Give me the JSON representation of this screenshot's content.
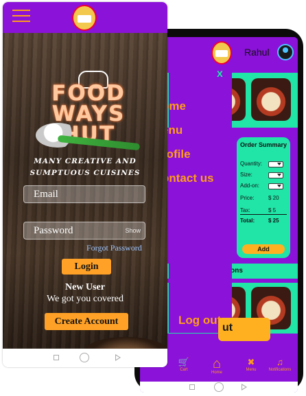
{
  "front_screen": {
    "logo_text": "FOOD WAYS HUT",
    "tagline_1": "MANY CREATIVE AND",
    "tagline_2": "SUMPTUOUS CUISINES",
    "email_placeholder": "Email",
    "password_placeholder": "Password",
    "show_label": "Show",
    "forgot_password": "Forgot Password",
    "login_button": "Login",
    "new_user_heading": "New User",
    "new_user_sub": "We got you covered",
    "create_account_button": "Create Account"
  },
  "back_screen": {
    "user_name": "Rahul",
    "drawer_close": "x",
    "drawer_items": [
      "ome",
      "enu",
      "rofile",
      "ontact us"
    ],
    "logout": "Log out",
    "button_fragment": "ut",
    "order_summary": {
      "title": "Order Summary",
      "quantity_label": "Quantity:",
      "size_label": "Size:",
      "addon_label": "Add-on:",
      "price_label": "Price:",
      "price_value": "$ 20",
      "tax_label": "Tax:",
      "tax_value": "$ 5",
      "total_label": "Total:",
      "total_value": "$ 25",
      "add_button": "Add"
    },
    "options_text": "tions",
    "bottom_nav": {
      "cart": "Cart",
      "home": "Home",
      "menu": "Menu",
      "notifications": "Notifications"
    }
  },
  "colors": {
    "purple": "#8a12d9",
    "orange": "#ff9d1a",
    "teal": "#21e4a7"
  }
}
